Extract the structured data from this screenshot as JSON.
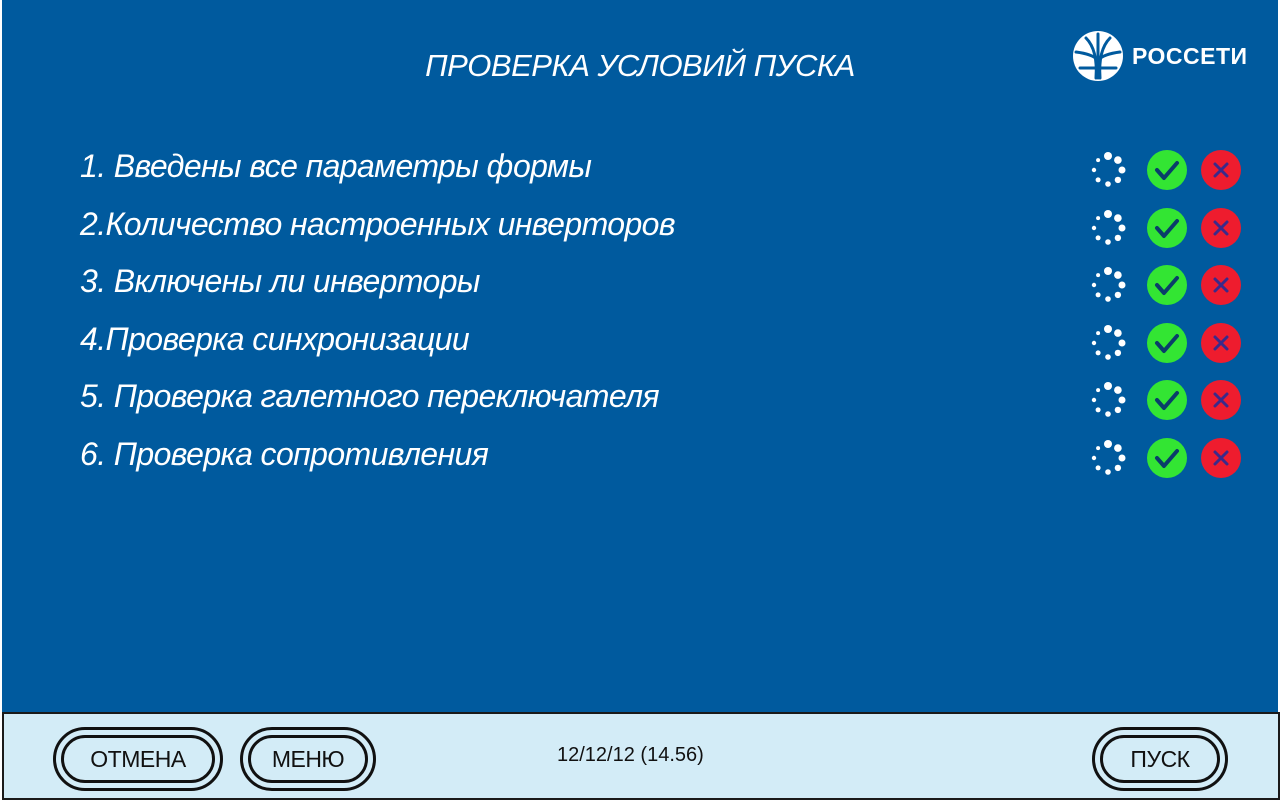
{
  "header": {
    "title": "ПРОВЕРКА УСЛОВИЙ ПУСКА",
    "logo_text": "РОССЕТИ"
  },
  "checks": [
    {
      "label": "1. Введены все параметры формы"
    },
    {
      "label": "2.Количество настроенных инверторов"
    },
    {
      "label": "3. Включены ли инверторы"
    },
    {
      "label": "4.Проверка синхронизации"
    },
    {
      "label": "5. Проверка галетного переключателя"
    },
    {
      "label": "6. Проверка сопротивления"
    }
  ],
  "status_icons": [
    "loading-spinner-icon",
    "check-circle-icon",
    "x-circle-icon"
  ],
  "footer": {
    "cancel_label": "ОТМЕНА",
    "menu_label": "МЕНЮ",
    "datetime": "12/12/12 (14.56)",
    "start_label": "ПУСК"
  },
  "colors": {
    "background": "#005a9e",
    "footer_bg": "#d3ecf7",
    "ok": "#33e533",
    "fail": "#ee1c2e",
    "text": "#ffffff"
  }
}
